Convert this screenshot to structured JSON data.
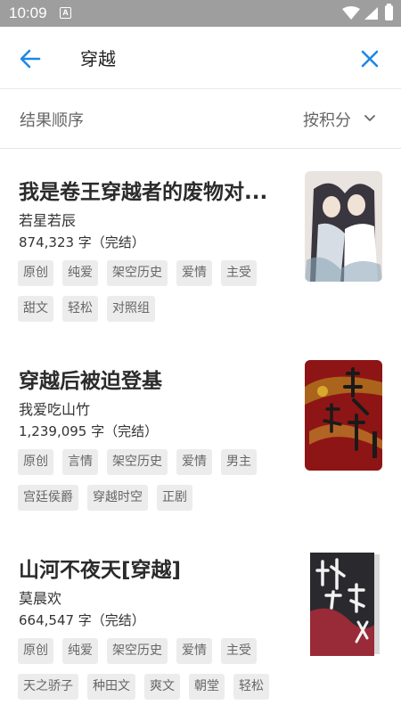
{
  "status_bar": {
    "time": "10:09",
    "notification_icon": "A"
  },
  "toolbar": {
    "title": "穿越",
    "back_icon": "arrow-left-icon",
    "close_icon": "close-icon",
    "accent_color": "#1e88e5"
  },
  "sort": {
    "label": "结果顺序",
    "value": "按积分"
  },
  "books": [
    {
      "title": "我是卷王穿越者的废物对...",
      "author": "若星若辰",
      "meta": "874,323 字（完结）",
      "tags": [
        "原创",
        "纯爱",
        "架空历史",
        "爱情",
        "主受",
        "甜文",
        "轻松",
        "对照组"
      ]
    },
    {
      "title": "穿越后被迫登基",
      "author": "我爱吃山竹",
      "meta": "1,239,095 字（完结）",
      "tags": [
        "原创",
        "言情",
        "架空历史",
        "爱情",
        "男主",
        "宫廷侯爵",
        "穿越时空",
        "正剧"
      ]
    },
    {
      "title": "山河不夜天[穿越]",
      "author": "莫晨欢",
      "meta": "664,547 字（完结）",
      "tags": [
        "原创",
        "纯爱",
        "架空历史",
        "爱情",
        "主受",
        "天之骄子",
        "种田文",
        "爽文",
        "朝堂",
        "轻松"
      ]
    }
  ]
}
